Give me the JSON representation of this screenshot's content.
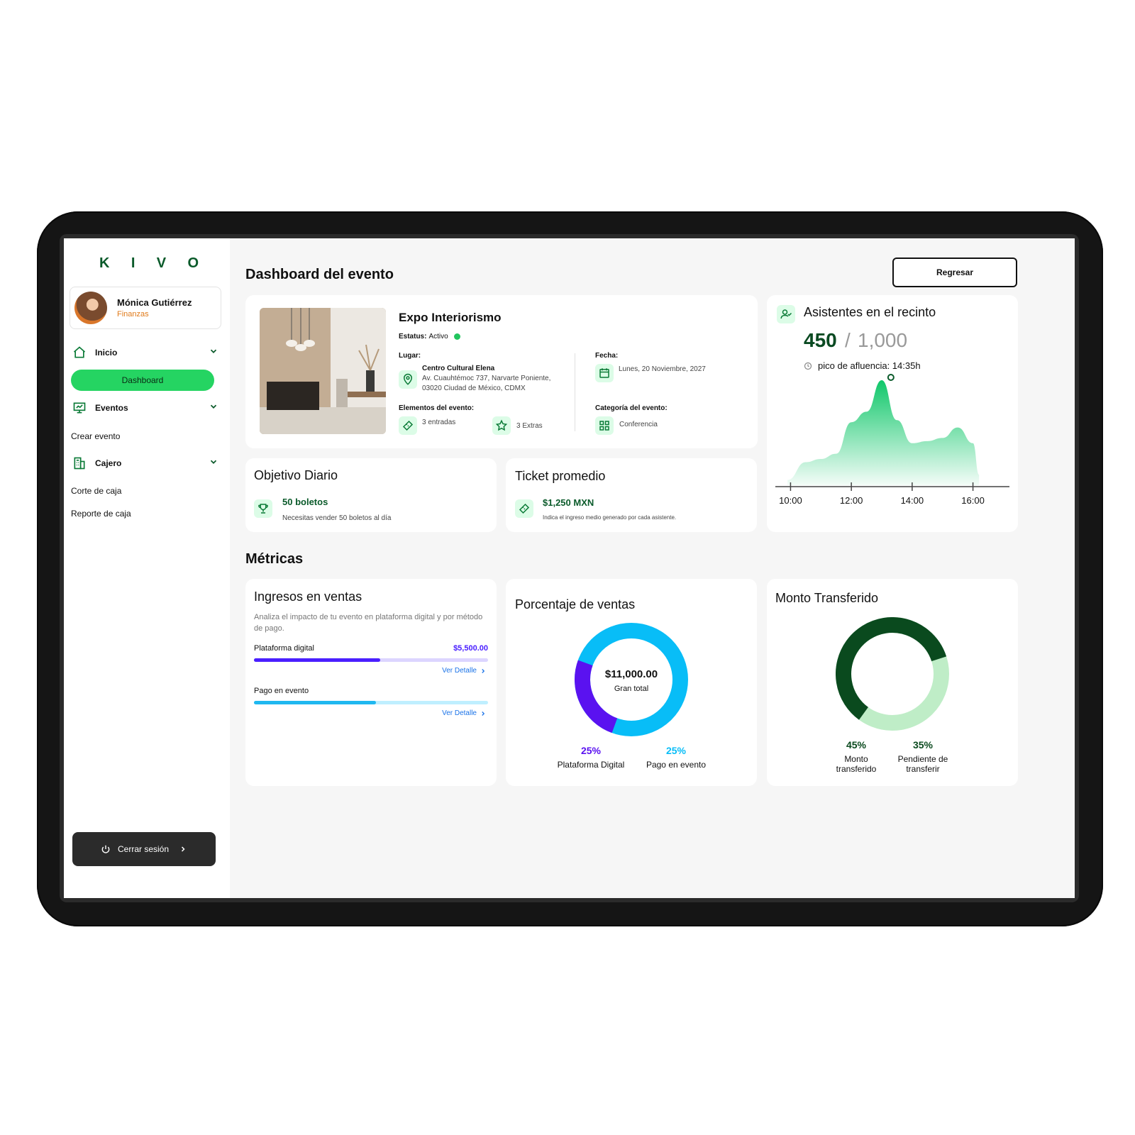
{
  "brand": {
    "letters": [
      "K",
      "I",
      "V",
      "O"
    ]
  },
  "user": {
    "name": "Mónica Gutiérrez",
    "role": "Finanzas"
  },
  "nav": {
    "inicio": "Inicio",
    "dashboard": "Dashboard",
    "eventos": "Eventos",
    "crear_evento": "Crear evento",
    "cajero": "Cajero",
    "corte_caja": "Corte de caja",
    "reporte_caja": "Reporte de caja",
    "logout": "Cerrar sesión"
  },
  "header": {
    "title": "Dashboard del evento",
    "back_button": "Regresar"
  },
  "event": {
    "name": "Expo Interiorismo",
    "status_label": "Estatus:",
    "status_value": "Activo",
    "place_label": "Lugar:",
    "place_name": "Centro Cultural Elena",
    "place_line1": "Av. Cuauhtémoc 737, Narvarte Poniente,",
    "place_line2": "03020 Ciudad de México, CDMX",
    "date_label": "Fecha:",
    "date_value": "Lunes, 20 Noviembre, 2027",
    "elements_label": "Elementos del evento:",
    "entries": "3 entradas",
    "extras": "3 Extras",
    "category_label": "Categoría del evento:",
    "category_value": "Conferencia"
  },
  "daily_goal": {
    "title": "Objetivo Diario",
    "value": "50 boletos",
    "desc": "Necesitas vender 50 boletos al día"
  },
  "avg_ticket": {
    "title": "Ticket promedio",
    "value": "$1,250 MXN",
    "desc": "Indica el ingreso medio generado por cada asistente."
  },
  "attendees": {
    "title": "Asistentes en el recinto",
    "current": "450",
    "separator": "/",
    "capacity": "1,000",
    "peak": "pico de afluencia: 14:35h"
  },
  "chart_data": {
    "type": "area",
    "x": [
      9.9,
      10.5,
      11.0,
      11.5,
      12.0,
      12.5,
      13.0,
      13.5,
      14.0,
      14.5,
      15.0,
      15.5,
      16.0,
      16.2
    ],
    "values": [
      0.05,
      0.22,
      0.25,
      0.3,
      0.6,
      0.7,
      1.0,
      0.62,
      0.4,
      0.42,
      0.45,
      0.55,
      0.4,
      0.1
    ],
    "x_ticks": [
      "10:00",
      "12:00",
      "14:00",
      "16:00"
    ],
    "x_tick_values": [
      10,
      12,
      14,
      16
    ],
    "xlim": [
      9.5,
      17.2
    ],
    "peak_x": 13.3,
    "color": "#10c76a"
  },
  "metrics": {
    "section_title": "Métricas"
  },
  "sales_income": {
    "title": "Ingresos en ventas",
    "desc": "Analiza el impacto de tu evento en plataforma digital y por método de pago.",
    "bar1_label": "Plataforma digital",
    "bar1_value": "$5,500.00",
    "bar1_fill": 0.54,
    "bar1_color": "#4a1fff",
    "bar1_track": "#dcd5ff",
    "bar2_label": "Pago en evento",
    "bar2_fill": 0.52,
    "bar2_color": "#1fb8f0",
    "bar2_track": "#bfefff",
    "link": "Ver Detalle"
  },
  "sales_pct": {
    "title": "Porcentaje de ventas",
    "total": "$11,000.00",
    "total_label": "Gran total",
    "a_pct": "25%",
    "a_label": "Plataforma Digital",
    "a_color": "#5a12f0",
    "b_pct": "25%",
    "b_label": "Pago en evento",
    "b_color": "#08bdf7",
    "a_share": 0.25
  },
  "transfer": {
    "title": "Monto Transferido",
    "a_pct": "45%",
    "a_label1": "Monto",
    "a_label2": "transferido",
    "b_pct": "35%",
    "b_label1": "Pendiente de",
    "b_label2": "transferir",
    "a_color": "#0a4a1e",
    "b_color": "#bfedc7",
    "a_share": 0.6
  }
}
